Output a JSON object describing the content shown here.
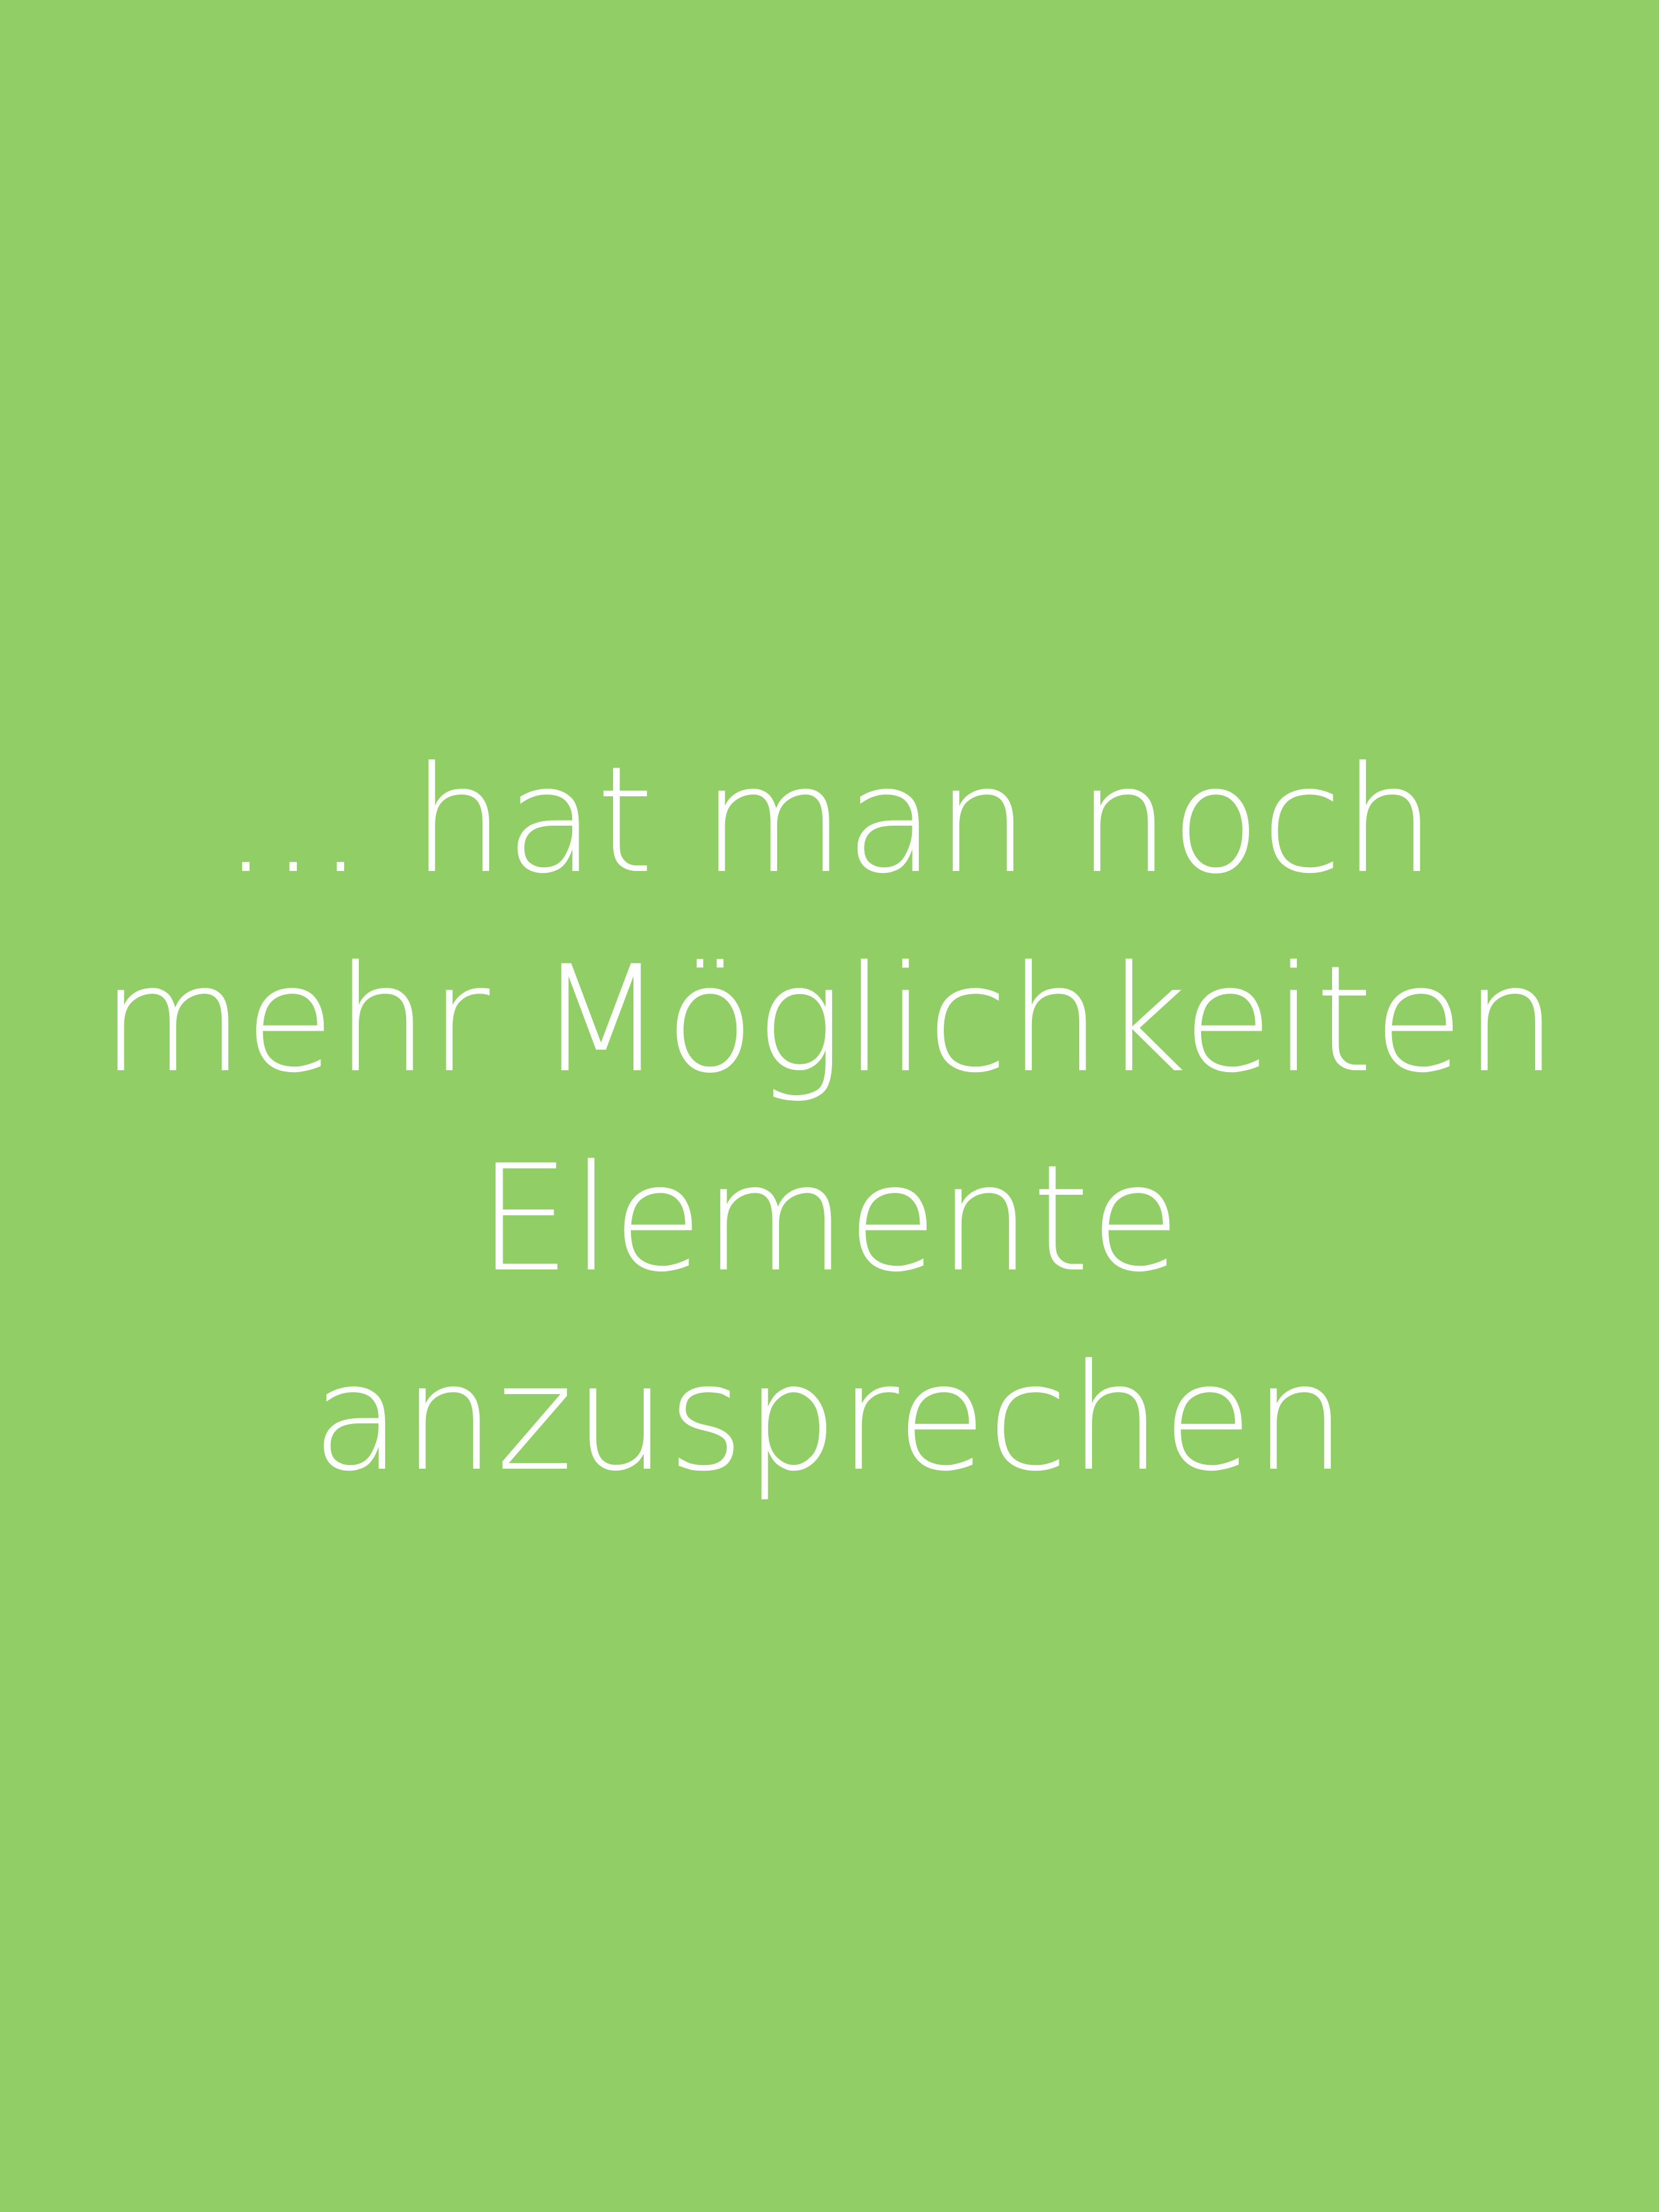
{
  "slide": {
    "background_color": "#91ce66",
    "text_color": "#ffffff",
    "lines": [
      "... hat man noch",
      "mehr Möglichkeiten",
      "Elemente",
      "anzusprechen"
    ]
  }
}
